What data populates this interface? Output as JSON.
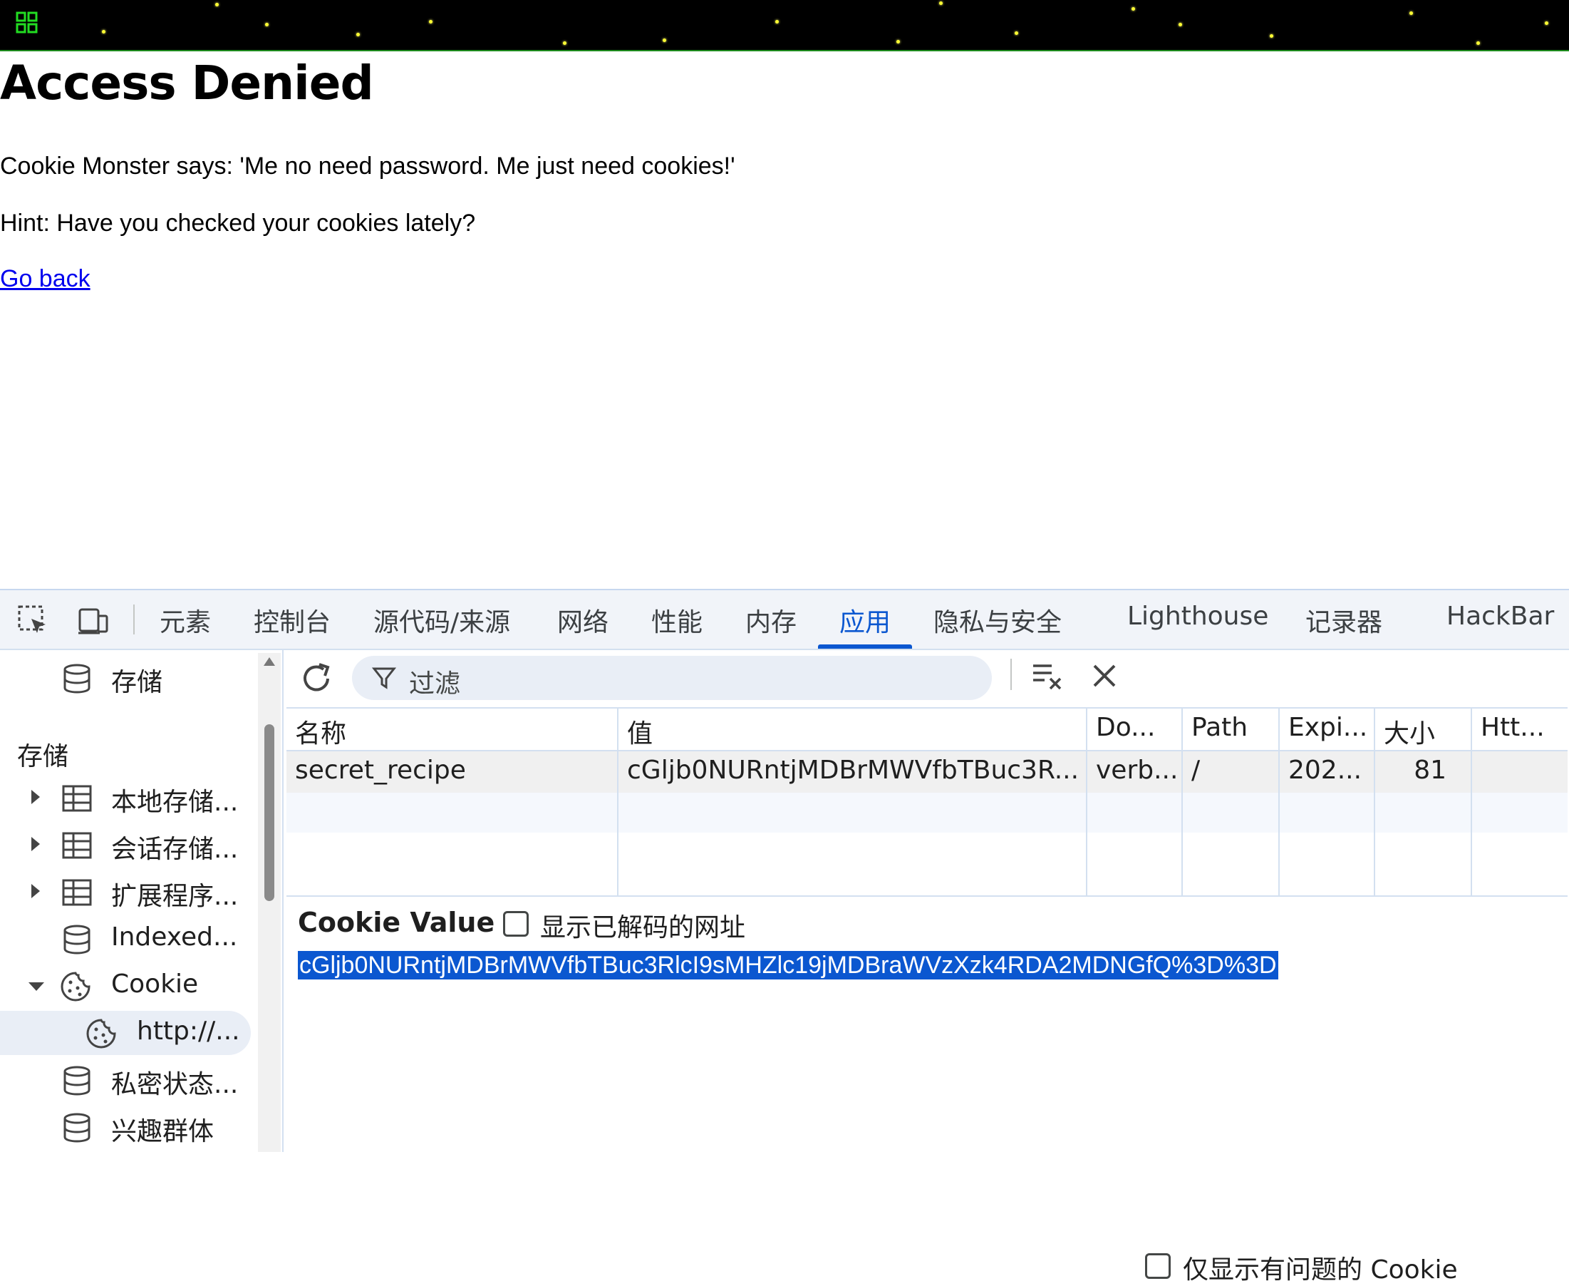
{
  "page": {
    "title": "Access Denied",
    "message": "Cookie Monster says: 'Me no need password. Me just need cookies!'",
    "hint": "Hint: Have you checked your cookies lately?",
    "link": "Go back"
  },
  "devtools": {
    "tabs": [
      "元素",
      "控制台",
      "源代码/来源",
      "网络",
      "性能",
      "内存",
      "应用",
      "隐私与安全",
      "Lighthouse",
      "记录器",
      "HackBar"
    ],
    "active_tab": "应用",
    "sidebar": {
      "top_item": "存储",
      "section_header": "存储",
      "items": [
        {
          "label": "本地存储...",
          "icon": "table-icon",
          "expandable": true
        },
        {
          "label": "会话存储...",
          "icon": "table-icon",
          "expandable": true
        },
        {
          "label": "扩展程序...",
          "icon": "table-icon",
          "expandable": true
        },
        {
          "label": "Indexed...",
          "icon": "database-icon",
          "expandable": false
        },
        {
          "label": "Cookie",
          "icon": "cookie-icon",
          "expanded": true
        },
        {
          "label": "http://...",
          "icon": "cookie-icon",
          "selected": true
        },
        {
          "label": "私密状态...",
          "icon": "database-icon",
          "expandable": false
        },
        {
          "label": "兴趣群体",
          "icon": "database-icon",
          "expandable": false
        }
      ]
    },
    "toolbar": {
      "filter_placeholder": "过滤",
      "only_issues_label": "仅显示有问题的 Cookie"
    },
    "table": {
      "columns": [
        "名称",
        "值",
        "Do...",
        "Path",
        "Expi...",
        "大小",
        "Htt..."
      ],
      "rows": [
        [
          "secret_recipe",
          "cGljb0NURntjMDBrMWVfbTBuc3R...",
          "verb...",
          "/",
          "202...",
          "81",
          ""
        ]
      ]
    },
    "value_pane": {
      "title": "Cookie Value",
      "show_decoded_label": "显示已解码的网址",
      "value": "cGljb0NURntjMDBrMWVfbTBuc3RlcI9sMHZlc19jMDBraWVzXzk4RDA2MDNGfQ%3D%3D"
    }
  },
  "colors": {
    "accent": "#0b57d0",
    "banner_bg": "#000000",
    "star": "#ffff33",
    "link": "#0000ee"
  }
}
